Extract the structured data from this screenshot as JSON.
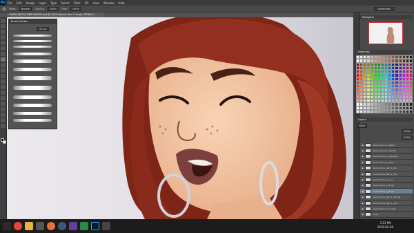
{
  "menubar": {
    "app_logo": "Ps",
    "items": [
      "File",
      "Edit",
      "Image",
      "Layer",
      "Type",
      "Select",
      "Filter",
      "3D",
      "View",
      "Window",
      "Help"
    ]
  },
  "options": {
    "mode_label": "Mode:",
    "mode_value": "Normal",
    "opacity_label": "Opacity:",
    "opacity_value": "100%",
    "flow_label": "Flow:",
    "flow_value": "100%",
    "workspace": "Essentials"
  },
  "document": {
    "tab_title": "CHARL BECCA NEW NAKED.psd @ 100% (becca face 2 laugh, RGB/8) *"
  },
  "brush_panel": {
    "title": "Brush Presets",
    "size_value": "21 px"
  },
  "right": {
    "navigator_title": "Navigator",
    "swatches_title": "Swatches",
    "layers_title": "Layers",
    "layers_kind": "Kind",
    "layers_opacity": "100%",
    "layers_fill": "100%",
    "layers": [
      "becca_face_2_happy",
      "becca_face_2_neutral",
      "becca_face_2_surprised",
      "becca_face_2_grace",
      "becca_face_talk_2_shy",
      "becca_face_talk_2_nerv",
      "becca_face_2_nerv",
      "becca_face_2_laugh",
      "becca_face_2_laugh",
      "becca_face_talk_2_normal",
      "becca_face_talk_2_nerv",
      "becca_face_2_normal",
      "body"
    ],
    "selected_layer_index": 8
  },
  "colors": {
    "hair": "#8f2f1f",
    "skin": "#f3c6a3",
    "lips": "#8a4a4a",
    "canvas_bg": "#e8e7ea"
  },
  "taskbar": {
    "time": "3:13 PM",
    "date": "2019-02-06"
  }
}
